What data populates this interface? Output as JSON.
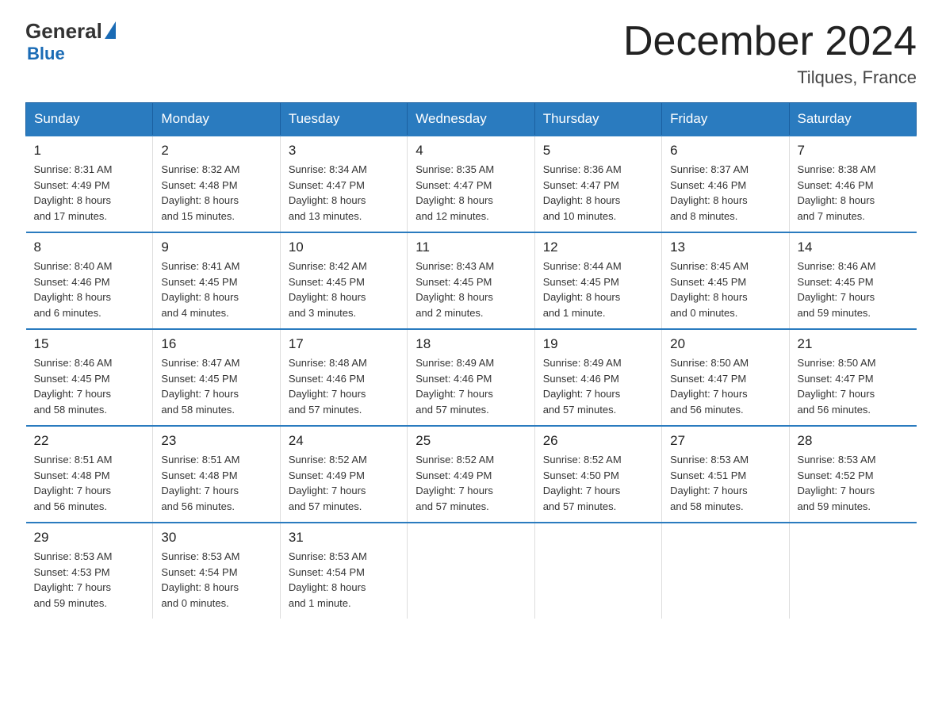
{
  "logo": {
    "general": "General",
    "blue": "Blue"
  },
  "header": {
    "month": "December 2024",
    "location": "Tilques, France"
  },
  "days_of_week": [
    "Sunday",
    "Monday",
    "Tuesday",
    "Wednesday",
    "Thursday",
    "Friday",
    "Saturday"
  ],
  "weeks": [
    [
      {
        "day": "1",
        "info": "Sunrise: 8:31 AM\nSunset: 4:49 PM\nDaylight: 8 hours\nand 17 minutes."
      },
      {
        "day": "2",
        "info": "Sunrise: 8:32 AM\nSunset: 4:48 PM\nDaylight: 8 hours\nand 15 minutes."
      },
      {
        "day": "3",
        "info": "Sunrise: 8:34 AM\nSunset: 4:47 PM\nDaylight: 8 hours\nand 13 minutes."
      },
      {
        "day": "4",
        "info": "Sunrise: 8:35 AM\nSunset: 4:47 PM\nDaylight: 8 hours\nand 12 minutes."
      },
      {
        "day": "5",
        "info": "Sunrise: 8:36 AM\nSunset: 4:47 PM\nDaylight: 8 hours\nand 10 minutes."
      },
      {
        "day": "6",
        "info": "Sunrise: 8:37 AM\nSunset: 4:46 PM\nDaylight: 8 hours\nand 8 minutes."
      },
      {
        "day": "7",
        "info": "Sunrise: 8:38 AM\nSunset: 4:46 PM\nDaylight: 8 hours\nand 7 minutes."
      }
    ],
    [
      {
        "day": "8",
        "info": "Sunrise: 8:40 AM\nSunset: 4:46 PM\nDaylight: 8 hours\nand 6 minutes."
      },
      {
        "day": "9",
        "info": "Sunrise: 8:41 AM\nSunset: 4:45 PM\nDaylight: 8 hours\nand 4 minutes."
      },
      {
        "day": "10",
        "info": "Sunrise: 8:42 AM\nSunset: 4:45 PM\nDaylight: 8 hours\nand 3 minutes."
      },
      {
        "day": "11",
        "info": "Sunrise: 8:43 AM\nSunset: 4:45 PM\nDaylight: 8 hours\nand 2 minutes."
      },
      {
        "day": "12",
        "info": "Sunrise: 8:44 AM\nSunset: 4:45 PM\nDaylight: 8 hours\nand 1 minute."
      },
      {
        "day": "13",
        "info": "Sunrise: 8:45 AM\nSunset: 4:45 PM\nDaylight: 8 hours\nand 0 minutes."
      },
      {
        "day": "14",
        "info": "Sunrise: 8:46 AM\nSunset: 4:45 PM\nDaylight: 7 hours\nand 59 minutes."
      }
    ],
    [
      {
        "day": "15",
        "info": "Sunrise: 8:46 AM\nSunset: 4:45 PM\nDaylight: 7 hours\nand 58 minutes."
      },
      {
        "day": "16",
        "info": "Sunrise: 8:47 AM\nSunset: 4:45 PM\nDaylight: 7 hours\nand 58 minutes."
      },
      {
        "day": "17",
        "info": "Sunrise: 8:48 AM\nSunset: 4:46 PM\nDaylight: 7 hours\nand 57 minutes."
      },
      {
        "day": "18",
        "info": "Sunrise: 8:49 AM\nSunset: 4:46 PM\nDaylight: 7 hours\nand 57 minutes."
      },
      {
        "day": "19",
        "info": "Sunrise: 8:49 AM\nSunset: 4:46 PM\nDaylight: 7 hours\nand 57 minutes."
      },
      {
        "day": "20",
        "info": "Sunrise: 8:50 AM\nSunset: 4:47 PM\nDaylight: 7 hours\nand 56 minutes."
      },
      {
        "day": "21",
        "info": "Sunrise: 8:50 AM\nSunset: 4:47 PM\nDaylight: 7 hours\nand 56 minutes."
      }
    ],
    [
      {
        "day": "22",
        "info": "Sunrise: 8:51 AM\nSunset: 4:48 PM\nDaylight: 7 hours\nand 56 minutes."
      },
      {
        "day": "23",
        "info": "Sunrise: 8:51 AM\nSunset: 4:48 PM\nDaylight: 7 hours\nand 56 minutes."
      },
      {
        "day": "24",
        "info": "Sunrise: 8:52 AM\nSunset: 4:49 PM\nDaylight: 7 hours\nand 57 minutes."
      },
      {
        "day": "25",
        "info": "Sunrise: 8:52 AM\nSunset: 4:49 PM\nDaylight: 7 hours\nand 57 minutes."
      },
      {
        "day": "26",
        "info": "Sunrise: 8:52 AM\nSunset: 4:50 PM\nDaylight: 7 hours\nand 57 minutes."
      },
      {
        "day": "27",
        "info": "Sunrise: 8:53 AM\nSunset: 4:51 PM\nDaylight: 7 hours\nand 58 minutes."
      },
      {
        "day": "28",
        "info": "Sunrise: 8:53 AM\nSunset: 4:52 PM\nDaylight: 7 hours\nand 59 minutes."
      }
    ],
    [
      {
        "day": "29",
        "info": "Sunrise: 8:53 AM\nSunset: 4:53 PM\nDaylight: 7 hours\nand 59 minutes."
      },
      {
        "day": "30",
        "info": "Sunrise: 8:53 AM\nSunset: 4:54 PM\nDaylight: 8 hours\nand 0 minutes."
      },
      {
        "day": "31",
        "info": "Sunrise: 8:53 AM\nSunset: 4:54 PM\nDaylight: 8 hours\nand 1 minute."
      },
      {
        "day": "",
        "info": ""
      },
      {
        "day": "",
        "info": ""
      },
      {
        "day": "",
        "info": ""
      },
      {
        "day": "",
        "info": ""
      }
    ]
  ]
}
